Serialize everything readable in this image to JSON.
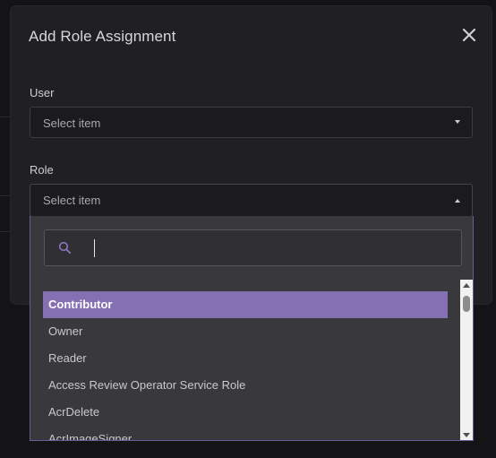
{
  "modal": {
    "title": "Add Role Assignment"
  },
  "user_field": {
    "label": "User",
    "placeholder": "Select item"
  },
  "role_field": {
    "label": "Role",
    "placeholder": "Select item",
    "search_value": "",
    "options": [
      {
        "label": "Contributor",
        "selected": true
      },
      {
        "label": "Owner",
        "selected": false
      },
      {
        "label": "Reader",
        "selected": false
      },
      {
        "label": "Access Review Operator Service Role",
        "selected": false
      },
      {
        "label": "AcrDelete",
        "selected": false
      },
      {
        "label": "AcrImageSigner",
        "selected": false
      }
    ]
  },
  "icons": {
    "close": "close-icon",
    "search": "search-icon",
    "user_caret": "chevron-down-icon",
    "role_caret": "chevron-up-icon"
  },
  "colors": {
    "accent": "#8470b3",
    "dropdown_border": "#6d5a99",
    "modal_bg": "#202024",
    "dropdown_bg": "#38383d"
  }
}
